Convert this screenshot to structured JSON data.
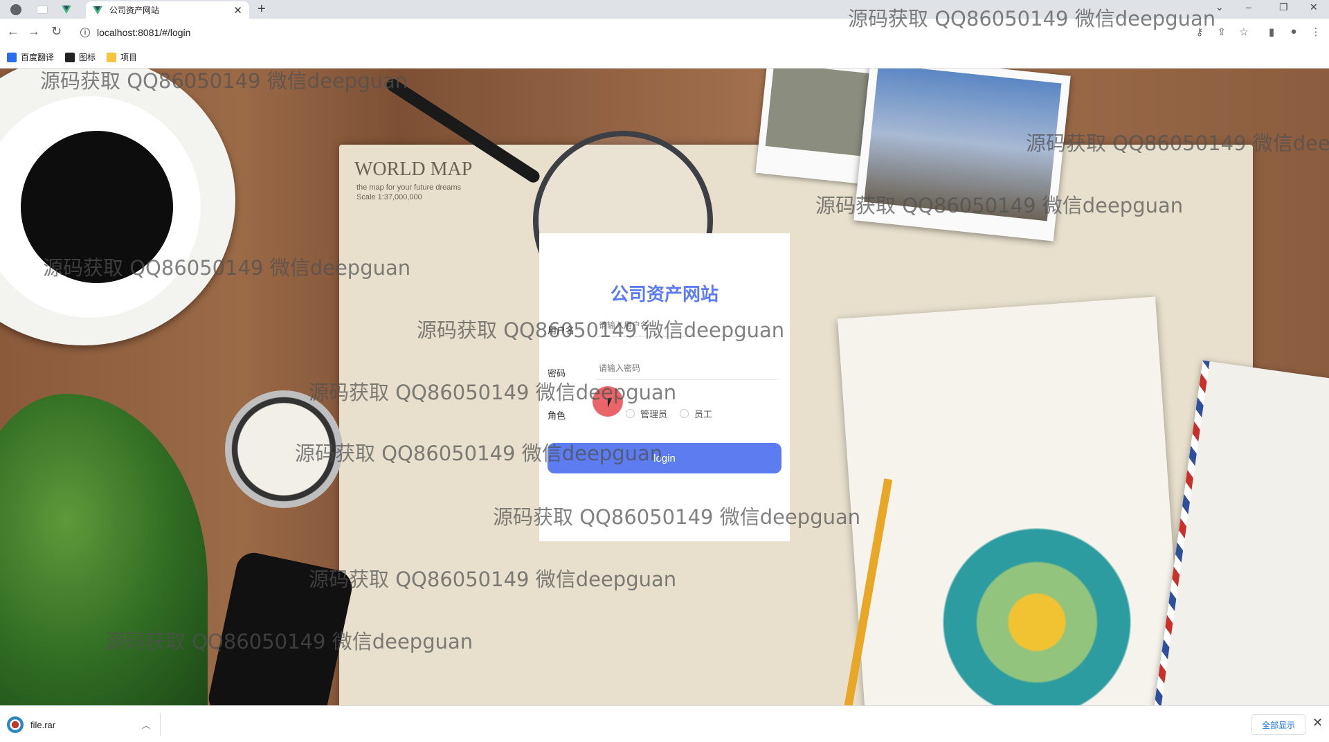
{
  "browser": {
    "tab_title": "公司资产网站",
    "url": "localhost:8081/#/login",
    "bookmarks": [
      "百度翻译",
      "图标",
      "项目"
    ]
  },
  "login": {
    "title": "公司资产网站",
    "username_label": "用户名",
    "username_placeholder": "请输入用户名",
    "password_label": "密码",
    "password_placeholder": "请输入密码",
    "role_label": "角色",
    "roles": [
      "管理员",
      "员工"
    ],
    "button": "login"
  },
  "background": {
    "map_title": "WORLD MAP",
    "map_subtitle": "the map for your future dreams",
    "map_scale": "Scale 1:37,000,000"
  },
  "watermark_text": "源码获取 QQ86050149 微信deepguan",
  "downloads": {
    "file_name": "file.rar",
    "show_all": "全部显示"
  },
  "icons": {
    "back": "arrow-left-icon",
    "forward": "arrow-right-icon",
    "reload": "reload-icon",
    "info": "info-icon",
    "key": "key-icon",
    "share": "share-icon",
    "star": "star-icon",
    "sidepanel": "side-panel-icon",
    "profile": "profile-icon",
    "menu": "kebab-menu-icon"
  },
  "colors": {
    "accent": "#5c7cf0",
    "cursor_highlight": "#e23238"
  }
}
